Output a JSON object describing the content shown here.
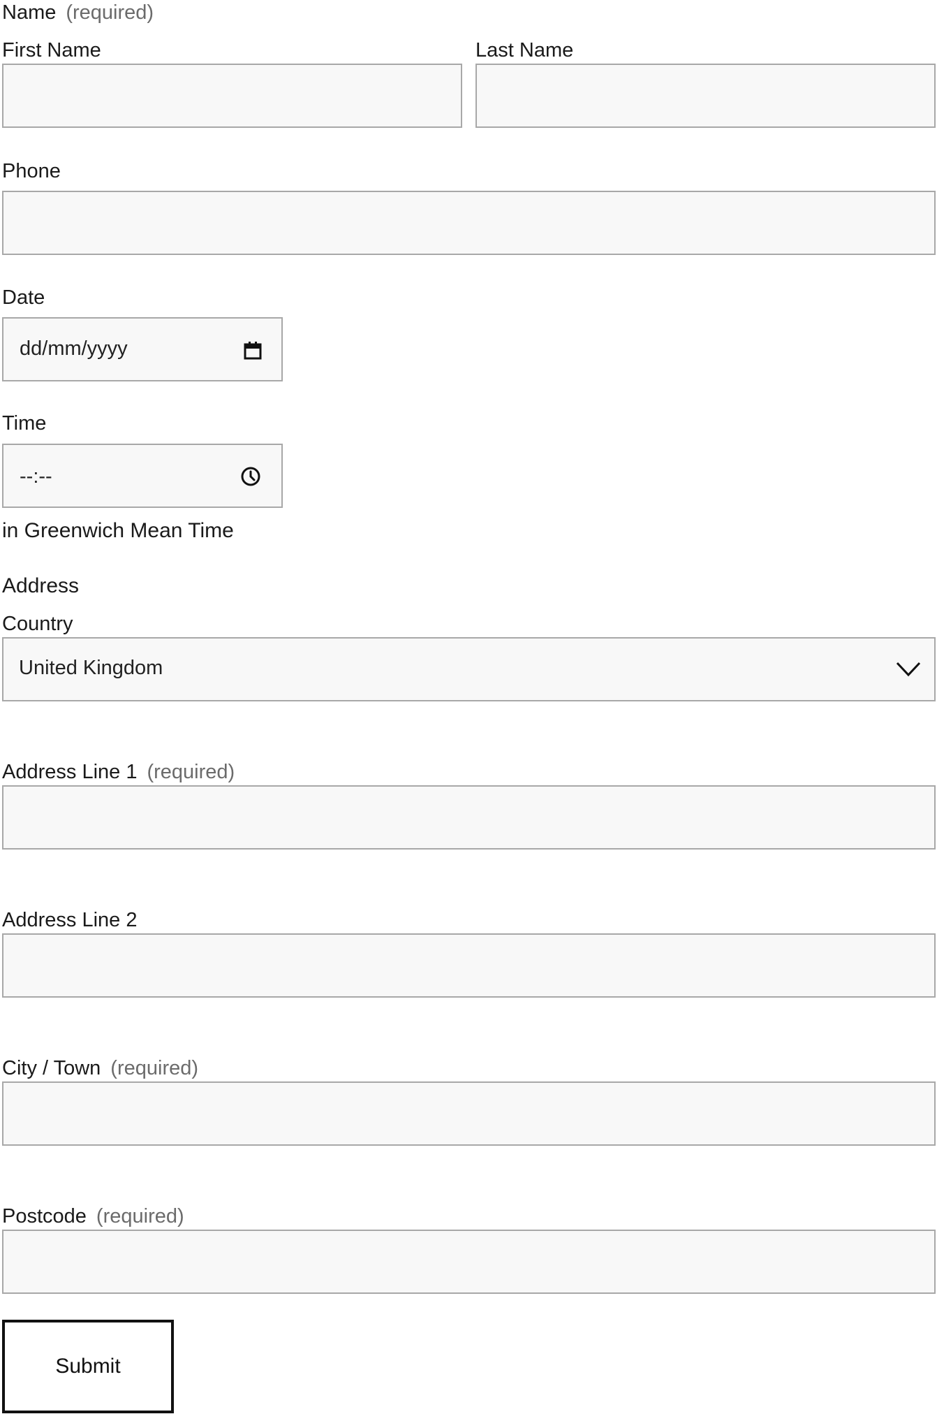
{
  "name": {
    "label": "Name",
    "required": "(required)"
  },
  "first_name": {
    "label": "First Name",
    "value": ""
  },
  "last_name": {
    "label": "Last Name",
    "value": ""
  },
  "phone": {
    "label": "Phone",
    "value": ""
  },
  "date": {
    "label": "Date",
    "placeholder": "dd/mm/yyyy",
    "icon": "calendar-icon"
  },
  "time": {
    "label": "Time",
    "placeholder": "--:--",
    "icon": "clock-icon",
    "timezone_note": "in Greenwich Mean Time"
  },
  "address": {
    "label": "Address",
    "country": {
      "label": "Country",
      "value": "United Kingdom",
      "icon": "chevron-down-icon"
    },
    "line1": {
      "label": "Address Line 1",
      "required": "(required)",
      "value": ""
    },
    "line2": {
      "label": "Address Line 2",
      "value": ""
    },
    "city": {
      "label": "City / Town",
      "required": "(required)",
      "value": ""
    },
    "postcode": {
      "label": "Postcode",
      "required": "(required)",
      "value": ""
    }
  },
  "submit": {
    "label": "Submit"
  }
}
